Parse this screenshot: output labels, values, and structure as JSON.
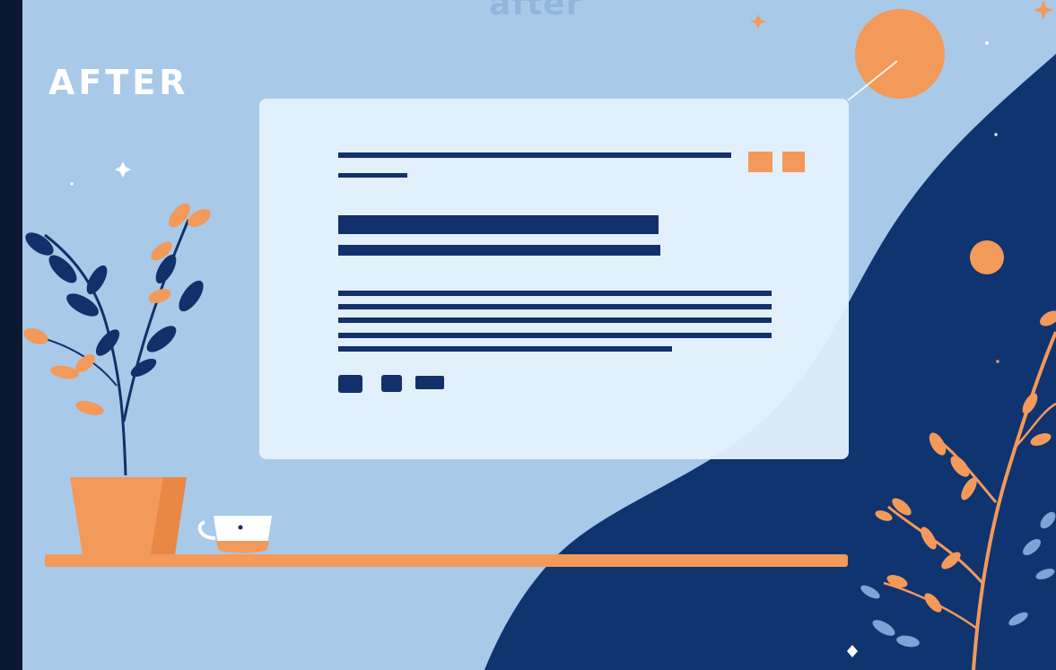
{
  "scene": {
    "top_word": "after",
    "heading": "AFTER"
  },
  "colors": {
    "background": "#a9c9e8",
    "dark_navy": "#0f3470",
    "card": "#e4f1fc",
    "accent_orange": "#f3995a",
    "white": "#ffffff"
  },
  "icons": [
    "sparkle-icon",
    "plant-pot",
    "coffee-cup",
    "orange-sun",
    "orange-branch"
  ]
}
